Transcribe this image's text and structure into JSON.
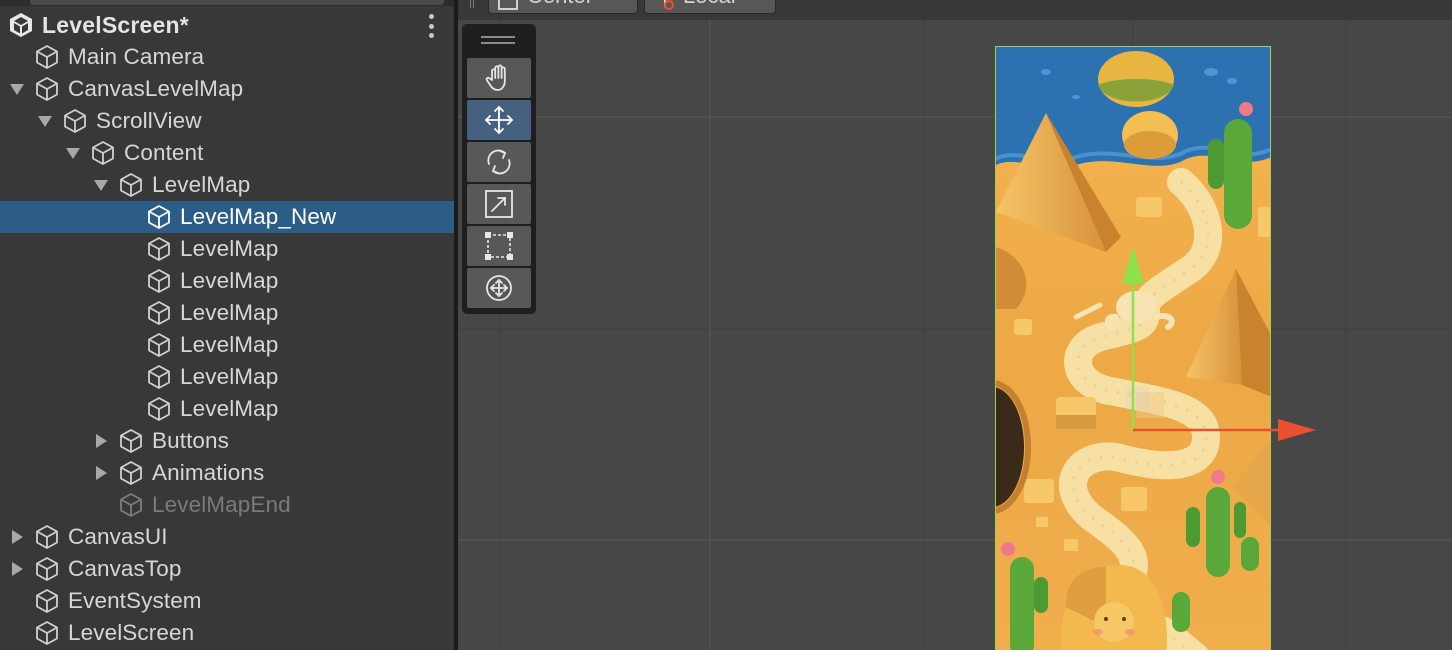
{
  "hierarchy": {
    "scene_title": "LevelScreen*",
    "items": [
      {
        "label": "Main Camera",
        "depth": 0,
        "fold": "none",
        "selected": false,
        "disabled": false
      },
      {
        "label": "CanvasLevelMap",
        "depth": 0,
        "fold": "expanded",
        "selected": false,
        "disabled": false
      },
      {
        "label": "ScrollView",
        "depth": 1,
        "fold": "expanded",
        "selected": false,
        "disabled": false
      },
      {
        "label": "Content",
        "depth": 2,
        "fold": "expanded",
        "selected": false,
        "disabled": false
      },
      {
        "label": "LevelMap",
        "depth": 3,
        "fold": "expanded",
        "selected": false,
        "disabled": false
      },
      {
        "label": "LevelMap_New",
        "depth": 4,
        "fold": "none",
        "selected": true,
        "disabled": false
      },
      {
        "label": "LevelMap",
        "depth": 4,
        "fold": "none",
        "selected": false,
        "disabled": false
      },
      {
        "label": "LevelMap",
        "depth": 4,
        "fold": "none",
        "selected": false,
        "disabled": false
      },
      {
        "label": "LevelMap",
        "depth": 4,
        "fold": "none",
        "selected": false,
        "disabled": false
      },
      {
        "label": "LevelMap",
        "depth": 4,
        "fold": "none",
        "selected": false,
        "disabled": false
      },
      {
        "label": "LevelMap",
        "depth": 4,
        "fold": "none",
        "selected": false,
        "disabled": false
      },
      {
        "label": "LevelMap",
        "depth": 4,
        "fold": "none",
        "selected": false,
        "disabled": false
      },
      {
        "label": "Buttons",
        "depth": 3,
        "fold": "collapsed",
        "selected": false,
        "disabled": false
      },
      {
        "label": "Animations",
        "depth": 3,
        "fold": "collapsed",
        "selected": false,
        "disabled": false
      },
      {
        "label": "LevelMapEnd",
        "depth": 3,
        "fold": "none",
        "selected": false,
        "disabled": true
      },
      {
        "label": "CanvasUI",
        "depth": 0,
        "fold": "collapsed",
        "selected": false,
        "disabled": false
      },
      {
        "label": "CanvasTop",
        "depth": 0,
        "fold": "collapsed",
        "selected": false,
        "disabled": false
      },
      {
        "label": "EventSystem",
        "depth": 0,
        "fold": "none",
        "selected": false,
        "disabled": false
      },
      {
        "label": "LevelScreen",
        "depth": 0,
        "fold": "none",
        "selected": false,
        "disabled": false
      }
    ]
  },
  "scene_view": {
    "toolbar": {
      "pivot_label": "Center",
      "space_label": "Local"
    },
    "tools": [
      {
        "name": "hand-tool",
        "icon": "hand-icon",
        "active": false
      },
      {
        "name": "move-tool",
        "icon": "move-arrows-icon",
        "active": true
      },
      {
        "name": "rotate-tool",
        "icon": "rotate-icon",
        "active": false
      },
      {
        "name": "scale-tool",
        "icon": "scale-icon",
        "active": false
      },
      {
        "name": "rect-tool",
        "icon": "rect-transform-icon",
        "active": false
      },
      {
        "name": "transform-tool",
        "icon": "transform-icon",
        "active": false
      }
    ]
  },
  "colors": {
    "selection": "#2c5d87",
    "active_tool": "#46607f",
    "gizmo_y": "#8fe04a",
    "gizmo_x": "#e8502e",
    "rect_outline": "#a6d24a"
  }
}
